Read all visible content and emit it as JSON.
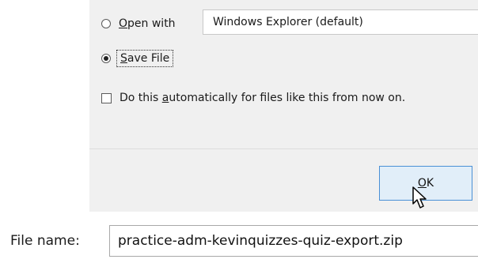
{
  "dialog": {
    "open_with": {
      "label_prefix": "",
      "label_underline": "O",
      "label_rest": "pen with",
      "selected": false,
      "app_value": "Windows Explorer (default)"
    },
    "save_file": {
      "label_underline": "S",
      "label_rest": "ave File",
      "selected": true
    },
    "auto_checkbox": {
      "label_prefix": "Do this ",
      "label_underline": "a",
      "label_rest": "utomatically for files like this from now on.",
      "checked": false
    },
    "ok_button": {
      "label_underline": "O",
      "label_rest": "K"
    }
  },
  "file_save": {
    "filename_label_prefix": "File name",
    "filename_label_suffix": ":",
    "filename_value": "practice-adm-kevinquizzes-quiz-export.zip"
  },
  "icons": {
    "cursor": "arrow-cursor-icon"
  },
  "colors": {
    "dialog_bg": "#f0f0f0",
    "ok_border": "#4a90d6",
    "ok_bg": "#e1eef9"
  }
}
